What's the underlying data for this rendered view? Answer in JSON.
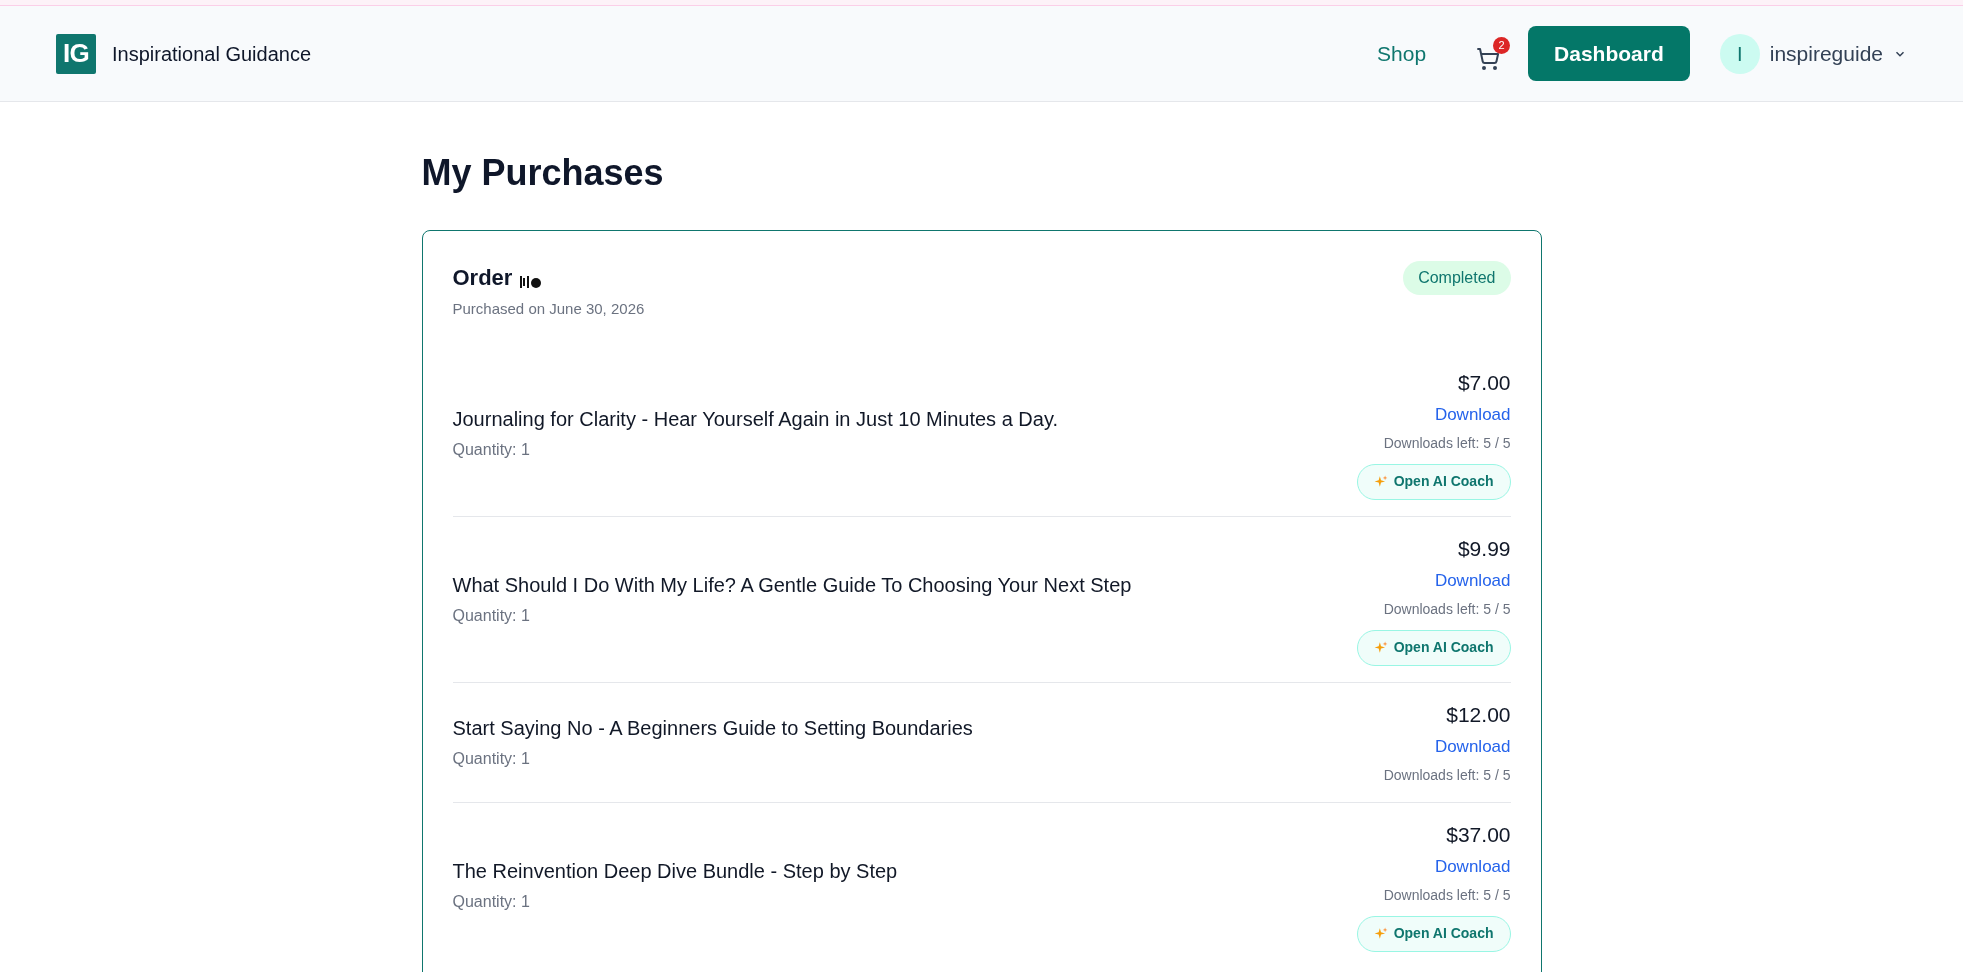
{
  "header": {
    "logo_text": "IG",
    "brand": "Inspirational Guidance",
    "nav": [
      {
        "label": "Shop"
      }
    ],
    "cart_count": "2",
    "primary_button": "Dashboard",
    "user": {
      "initial": "I",
      "name": "inspireguide"
    }
  },
  "page_title": "My Purchases",
  "order": {
    "title": "Order",
    "date": "Purchased on June 30, 2026",
    "status": "Completed",
    "items": [
      {
        "title": "Journaling for Clarity - Hear Yourself Again in Just 10 Minutes a Day.",
        "quantity": "Quantity: 1",
        "price": "$7.00",
        "download": "Download",
        "downloads_left": "Downloads left: 5 / 5",
        "coach_button": "Open AI Coach"
      },
      {
        "title": "What Should I Do With My Life? A Gentle Guide To Choosing Your Next Step",
        "quantity": "Quantity: 1",
        "price": "$9.99",
        "download": "Download",
        "downloads_left": "Downloads left: 5 / 5",
        "coach_button": "Open AI Coach"
      },
      {
        "title": "Start Saying No - A Beginners Guide to Setting Boundaries",
        "quantity": "Quantity: 1",
        "price": "$12.00",
        "download": "Download",
        "downloads_left": "Downloads left: 5 / 5"
      },
      {
        "title": "The Reinvention Deep Dive Bundle - Step by Step",
        "quantity": "Quantity: 1",
        "price": "$37.00",
        "download": "Download",
        "downloads_left": "Downloads left: 5 / 5",
        "coach_button": "Open AI Coach"
      }
    ]
  }
}
